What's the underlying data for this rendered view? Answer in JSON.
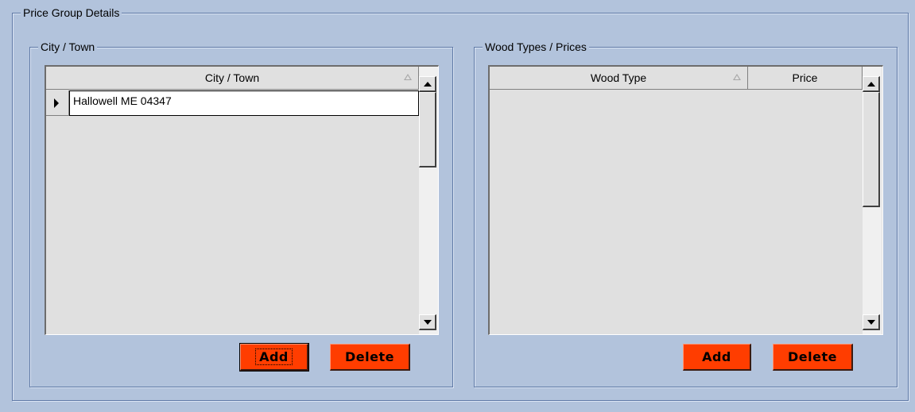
{
  "price_group": {
    "legend": "Price Group Details"
  },
  "city_panel": {
    "legend": "City / Town",
    "column_header": "City / Town",
    "rows": [
      "Hallowell ME 04347"
    ],
    "add_label": "Add",
    "delete_label": "Delete"
  },
  "wood_panel": {
    "legend": "Wood Types / Prices",
    "columns": [
      "Wood Type",
      "Price"
    ],
    "rows": [],
    "add_label": "Add",
    "delete_label": "Delete"
  },
  "colors": {
    "background": "#b2c3dc",
    "button_accent": "#ff3d00",
    "grid_background": "#e0e0e0"
  },
  "icons": {
    "sort": "sort-ascending-icon",
    "row_indicator": "current-row-arrow-icon",
    "scroll_up": "scroll-up-arrow-icon",
    "scroll_down": "scroll-down-arrow-icon"
  }
}
